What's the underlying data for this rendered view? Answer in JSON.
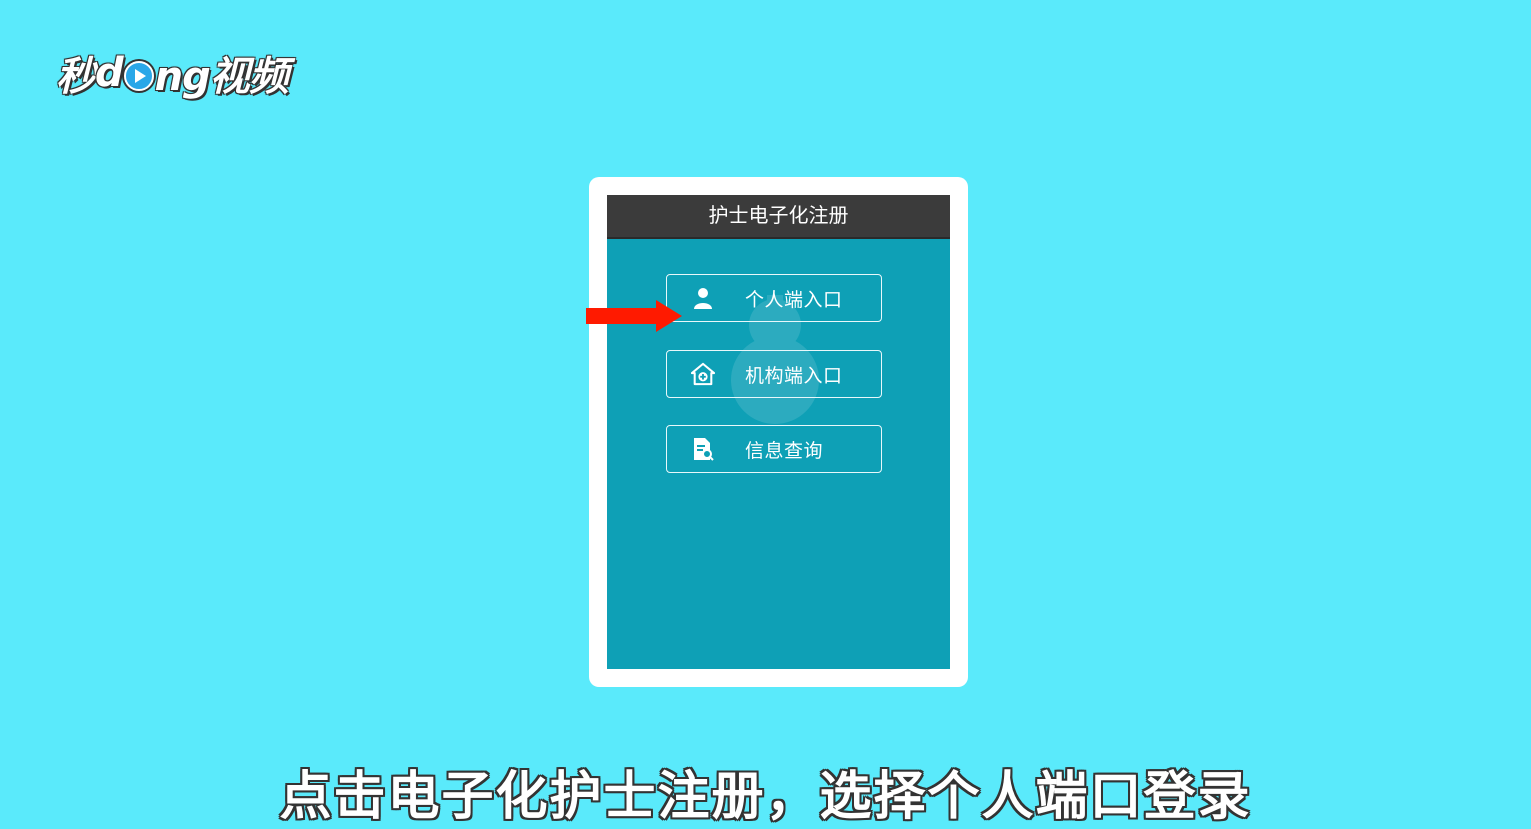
{
  "logo": {
    "part1": "秒",
    "part2": "d",
    "part3": "ng视频"
  },
  "app": {
    "title": "护士电子化注册",
    "buttons": [
      {
        "label": "个人端入口",
        "icon": "person-icon"
      },
      {
        "label": "机构端入口",
        "icon": "hospital-icon"
      },
      {
        "label": "信息查询",
        "icon": "document-search-icon"
      }
    ]
  },
  "annotation": {
    "arrow_color": "#ff1a00",
    "arrow_target": "个人端入口"
  },
  "subtitle": "点击电子化护士注册，选择个人端口登录",
  "colors": {
    "background": "#5aeafb",
    "screen": "#0ea0b6",
    "header": "#3b3b3b"
  }
}
